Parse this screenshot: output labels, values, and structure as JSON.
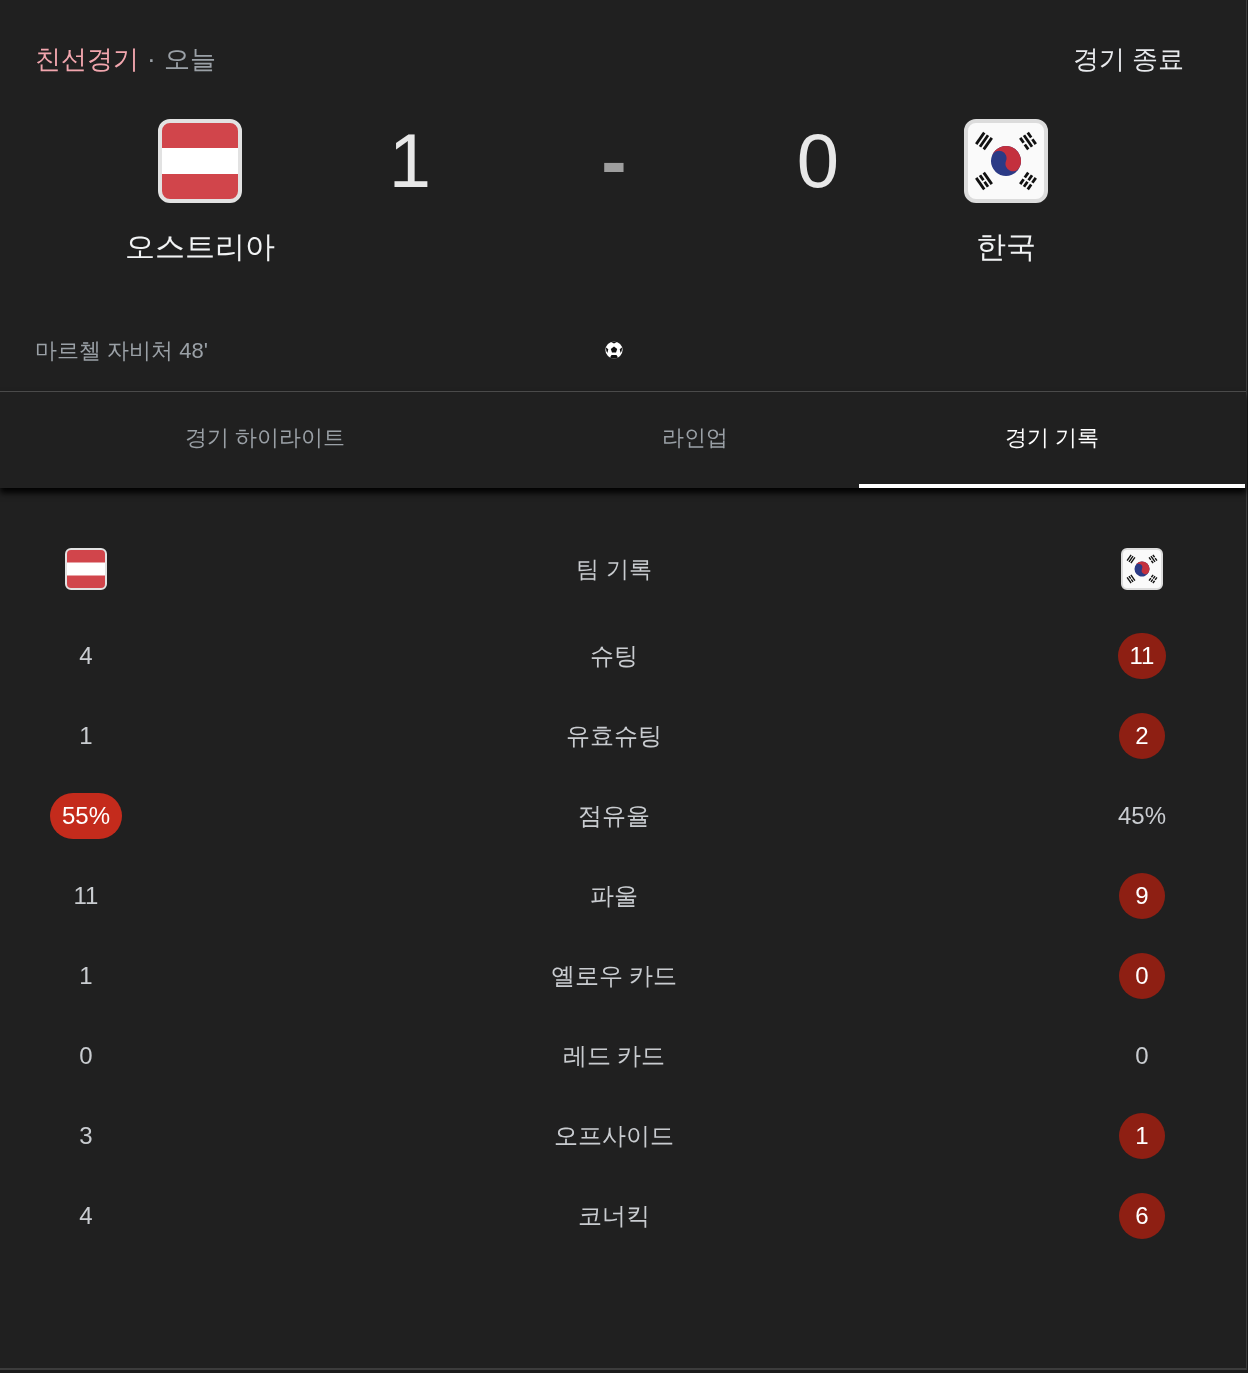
{
  "header": {
    "competition": "친선경기",
    "separator": "·",
    "date": "오늘",
    "status": "경기 종료"
  },
  "match": {
    "home": {
      "name": "오스트리아",
      "score": "1",
      "goals": [
        "마르첼 자비처 48'"
      ]
    },
    "score_separator": "-",
    "away": {
      "name": "한국",
      "score": "0"
    }
  },
  "tabs": [
    {
      "label": "경기 하이라이트",
      "selected": false
    },
    {
      "label": "라인업",
      "selected": false
    },
    {
      "label": "경기 기록",
      "selected": true
    }
  ],
  "stats": {
    "title": "팀 기록",
    "rows": [
      {
        "label": "슈팅",
        "home": {
          "value": "4",
          "highlighted": false
        },
        "away": {
          "value": "11",
          "highlighted": true
        }
      },
      {
        "label": "유효슈팅",
        "home": {
          "value": "1",
          "highlighted": false
        },
        "away": {
          "value": "2",
          "highlighted": true
        }
      },
      {
        "label": "점유율",
        "home": {
          "value": "55%",
          "highlighted": true
        },
        "away": {
          "value": "45%",
          "highlighted": false
        }
      },
      {
        "label": "파울",
        "home": {
          "value": "11",
          "highlighted": false
        },
        "away": {
          "value": "9",
          "highlighted": true
        }
      },
      {
        "label": "옐로우 카드",
        "home": {
          "value": "1",
          "highlighted": false
        },
        "away": {
          "value": "0",
          "highlighted": true
        }
      },
      {
        "label": "레드 카드",
        "home": {
          "value": "0",
          "highlighted": false
        },
        "away": {
          "value": "0",
          "highlighted": false
        }
      },
      {
        "label": "오프사이드",
        "home": {
          "value": "3",
          "highlighted": false
        },
        "away": {
          "value": "1",
          "highlighted": true
        }
      },
      {
        "label": "코너킥",
        "home": {
          "value": "4",
          "highlighted": false
        },
        "away": {
          "value": "6",
          "highlighted": true
        }
      }
    ]
  }
}
